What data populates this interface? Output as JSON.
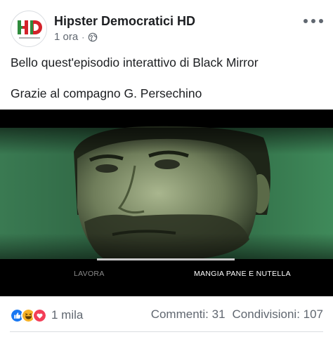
{
  "post": {
    "page_name": "Hipster Democratici HD",
    "time": "1 ora",
    "separator": "·",
    "privacy_icon": "globe-icon",
    "more_icon": "more-options-icon",
    "text_line1": "Bello quest'episodio interattivo di Black Mirror",
    "text_line2": "Grazie al compagno G. Persechino"
  },
  "avatar": {
    "logo_text": "HD",
    "logo_subtext": "Hipster Democratici",
    "colors": {
      "green": "#2e8b3c",
      "red": "#d3222a"
    }
  },
  "media": {
    "choices": [
      "LAVORA",
      "MANGIA PANE E NUTELLA"
    ],
    "choice_progress": 0.0
  },
  "footer": {
    "reaction_icons": [
      "like-icon",
      "haha-icon",
      "love-icon"
    ],
    "reactions_count": "1 mila",
    "comments": "Commenti: 31",
    "shares": "Condivisioni: 107"
  }
}
